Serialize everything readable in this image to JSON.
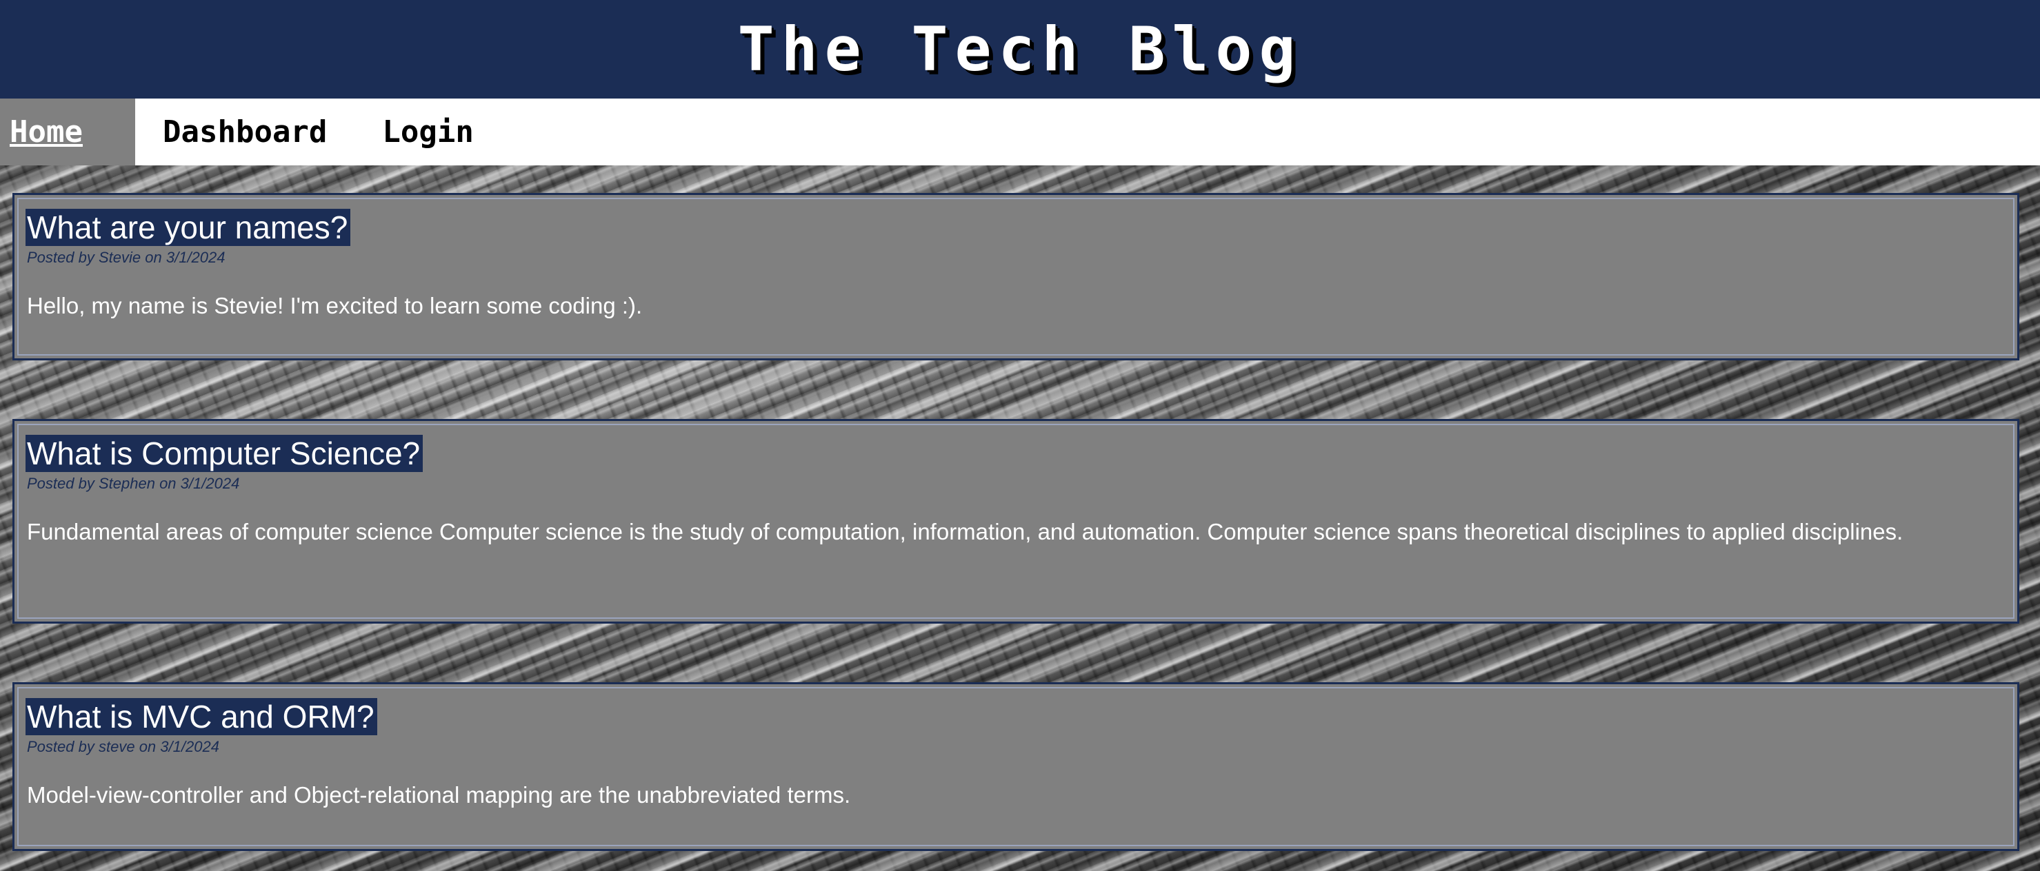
{
  "site": {
    "title": "The Tech Blog"
  },
  "nav": {
    "items": [
      {
        "label": "Home",
        "active": true
      },
      {
        "label": "Dashboard",
        "active": false
      },
      {
        "label": "Login",
        "active": false
      }
    ]
  },
  "posts": [
    {
      "title": "What are your names?",
      "meta_prefix": "Posted by",
      "author": "Stevie",
      "meta_mid": "on",
      "date": "3/1/2024",
      "body": "Hello, my name is Stevie! I'm excited to learn some coding :)."
    },
    {
      "title": "What is Computer Science?",
      "meta_prefix": "Posted by",
      "author": "Stephen",
      "meta_mid": "on",
      "date": "3/1/2024",
      "body": "Fundamental areas of computer science Computer science is the study of computation, information, and automation. Computer science spans theoretical disciplines to applied disciplines."
    },
    {
      "title": "What is MVC and ORM?",
      "meta_prefix": "Posted by",
      "author": "steve",
      "meta_mid": "on",
      "date": "3/1/2024",
      "body": "Model-view-controller and Object-relational mapping are the unabbreviated terms."
    }
  ],
  "colors": {
    "header_bg": "#1b2d55",
    "card_bg": "#808080",
    "nav_bg": "#ffffff",
    "active_nav_bg": "#808080"
  }
}
